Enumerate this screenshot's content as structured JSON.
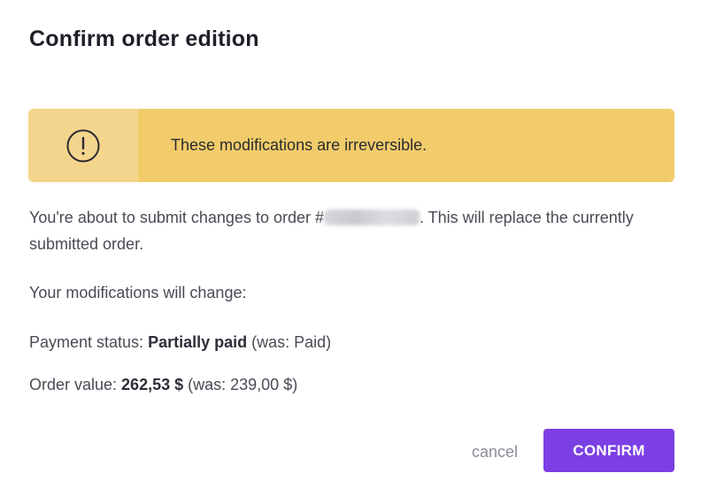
{
  "dialog": {
    "title": "Confirm order edition",
    "alert": {
      "icon": "exclamation-circle-icon",
      "text": "These modifications are irreversible.",
      "color": "#f2cc6b"
    },
    "intro": {
      "before": "You're about to submit changes to order #",
      "after": ". This will replace the currently submitted order."
    },
    "changes_heading": "Your modifications will change:",
    "payment_status": {
      "label": "Payment status: ",
      "value": "Partially paid",
      "previous": " (was: Paid)"
    },
    "order_value": {
      "label": "Order value: ",
      "value": "262,53 $",
      "previous": " (was: 239,00 $)"
    },
    "buttons": {
      "cancel": "cancel",
      "confirm": "CONFIRM"
    },
    "accent_color": "#7b3fe4"
  }
}
